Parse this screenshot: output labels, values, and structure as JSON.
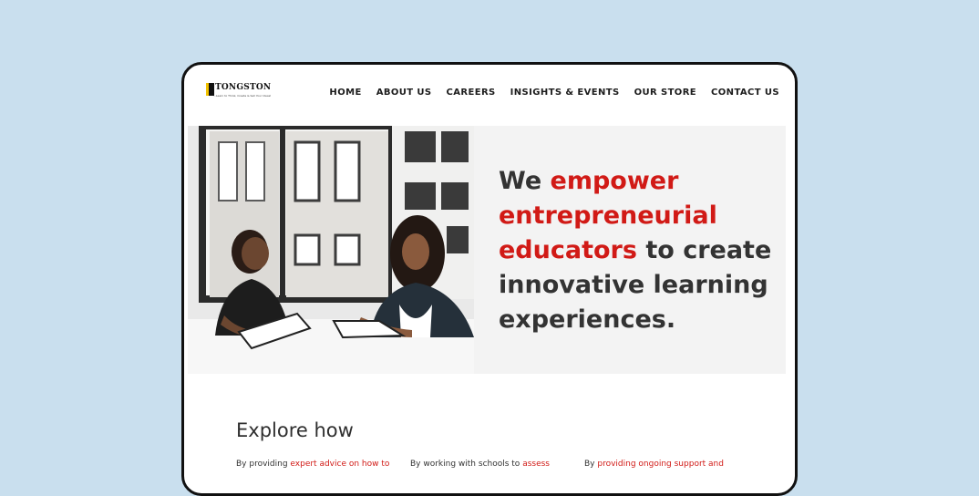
{
  "logo": {
    "name": "TONGSTON",
    "tagline": "...Learn to Think, Create & Sell Your Ideas!"
  },
  "nav": {
    "items": [
      "HOME",
      "ABOUT US",
      "CAREERS",
      "INSIGHTS & EVENTS",
      "OUR STORE",
      "CONTACT US"
    ]
  },
  "hero": {
    "image_alt": "Two women meeting at a table with notebooks",
    "headline": {
      "part1": "We ",
      "highlight1": "empower entrepreneurial educators",
      "part2": " to create innovative learning experiences."
    }
  },
  "explore": {
    "title": "Explore how",
    "columns": [
      {
        "text_plain": "By providing ",
        "text_highlight": "expert advice on how to"
      },
      {
        "text_plain": "By working with schools to ",
        "text_highlight": "assess"
      },
      {
        "text_plain": "By ",
        "text_highlight": "providing ongoing support and"
      }
    ]
  },
  "colors": {
    "accent": "#d11a16",
    "background": "#c9dfee",
    "panel": "#f3f3f3"
  }
}
